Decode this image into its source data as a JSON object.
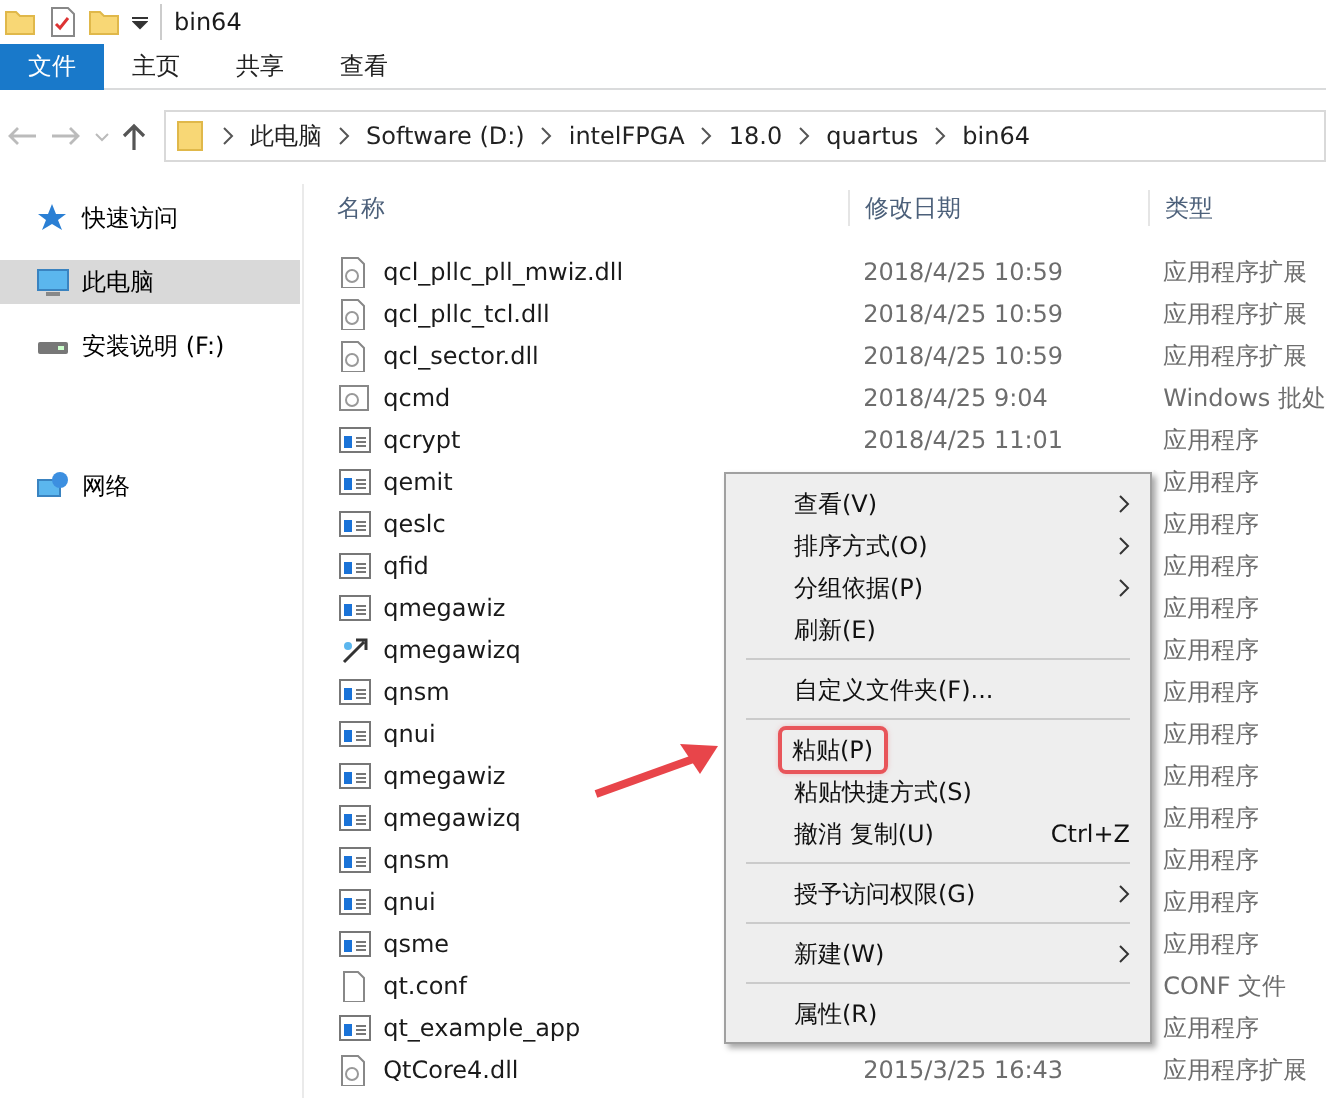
{
  "window": {
    "title": "bin64"
  },
  "ribbon_tabs": [
    {
      "label": "文件",
      "selected": true
    },
    {
      "label": "主页",
      "selected": false
    },
    {
      "label": "共享",
      "selected": false
    },
    {
      "label": "查看",
      "selected": false
    }
  ],
  "address_bar": {
    "crumbs": [
      "此电脑",
      "Software (D:)",
      "intelFPGA",
      "18.0",
      "quartus",
      "bin64"
    ]
  },
  "sidebar": {
    "items": [
      {
        "label": "快速访问",
        "kind": "star",
        "selected": false
      },
      {
        "label": "此电脑",
        "kind": "pc",
        "selected": true
      },
      {
        "label": "安装说明 (F:)",
        "kind": "drive",
        "selected": false
      },
      {
        "label": "网络",
        "kind": "network",
        "selected": false
      }
    ]
  },
  "table": {
    "columns": [
      "名称",
      "修改日期",
      "类型"
    ],
    "rows": [
      {
        "name": "qcl_pllc_pll_mwiz.dll",
        "kind": "dll",
        "date": "2018/4/25 10:59",
        "type": "应用程序扩展"
      },
      {
        "name": "qcl_pllc_tcl.dll",
        "kind": "dll",
        "date": "2018/4/25 10:59",
        "type": "应用程序扩展"
      },
      {
        "name": "qcl_sector.dll",
        "kind": "dll",
        "date": "2018/4/25 10:59",
        "type": "应用程序扩展"
      },
      {
        "name": "qcmd",
        "kind": "batch",
        "date": "2018/4/25 9:04",
        "type": "Windows 批处"
      },
      {
        "name": "qcrypt",
        "kind": "exe",
        "date": "2018/4/25 11:01",
        "type": "应用程序"
      },
      {
        "name": "qemit",
        "kind": "exe",
        "type": "应用程序"
      },
      {
        "name": "qeslc",
        "kind": "exe",
        "type": "应用程序"
      },
      {
        "name": "qfid",
        "kind": "exe",
        "type": "应用程序"
      },
      {
        "name": "qmegawiz",
        "kind": "exe",
        "type": "应用程序"
      },
      {
        "name": "qmegawizq",
        "kind": "shortcut",
        "type": "应用程序"
      },
      {
        "name": "qnsm",
        "kind": "exe",
        "type": "应用程序"
      },
      {
        "name": "qnui",
        "kind": "exe",
        "type": "应用程序"
      },
      {
        "name": "qmegawiz",
        "kind": "exe",
        "type": "应用程序"
      },
      {
        "name": "qmegawizq",
        "kind": "exe",
        "type": "应用程序"
      },
      {
        "name": "qnsm",
        "kind": "exe",
        "type": "应用程序"
      },
      {
        "name": "qnui",
        "kind": "exe",
        "type": "应用程序"
      },
      {
        "name": "qsme",
        "kind": "exe",
        "type": "应用程序"
      },
      {
        "name": "qt.conf",
        "kind": "file",
        "type": "CONF 文件"
      },
      {
        "name": "qt_example_app",
        "kind": "exe",
        "type": "应用程序"
      },
      {
        "name": "QtCore4.dll",
        "kind": "dll",
        "date": "2015/3/25 16:43",
        "type": "应用程序扩展"
      }
    ]
  },
  "context_menu": {
    "items": [
      {
        "kind": "item",
        "label": "查看(V)",
        "submenu": true
      },
      {
        "kind": "item",
        "label": "排序方式(O)",
        "submenu": true
      },
      {
        "kind": "item",
        "label": "分组依据(P)",
        "submenu": true
      },
      {
        "kind": "item",
        "label": "刷新(E)"
      },
      {
        "kind": "separator"
      },
      {
        "kind": "item",
        "label": "自定义文件夹(F)..."
      },
      {
        "kind": "separator"
      },
      {
        "kind": "item",
        "label": "粘贴(P)",
        "highlighted": true
      },
      {
        "kind": "item",
        "label": "粘贴快捷方式(S)"
      },
      {
        "kind": "item",
        "label": "撤消 复制(U)",
        "shortcut": "Ctrl+Z"
      },
      {
        "kind": "separator"
      },
      {
        "kind": "item",
        "label": "授予访问权限(G)",
        "submenu": true
      },
      {
        "kind": "separator"
      },
      {
        "kind": "item",
        "label": "新建(W)",
        "submenu": true
      },
      {
        "kind": "separator"
      },
      {
        "kind": "item",
        "label": "属性(R)"
      }
    ]
  }
}
